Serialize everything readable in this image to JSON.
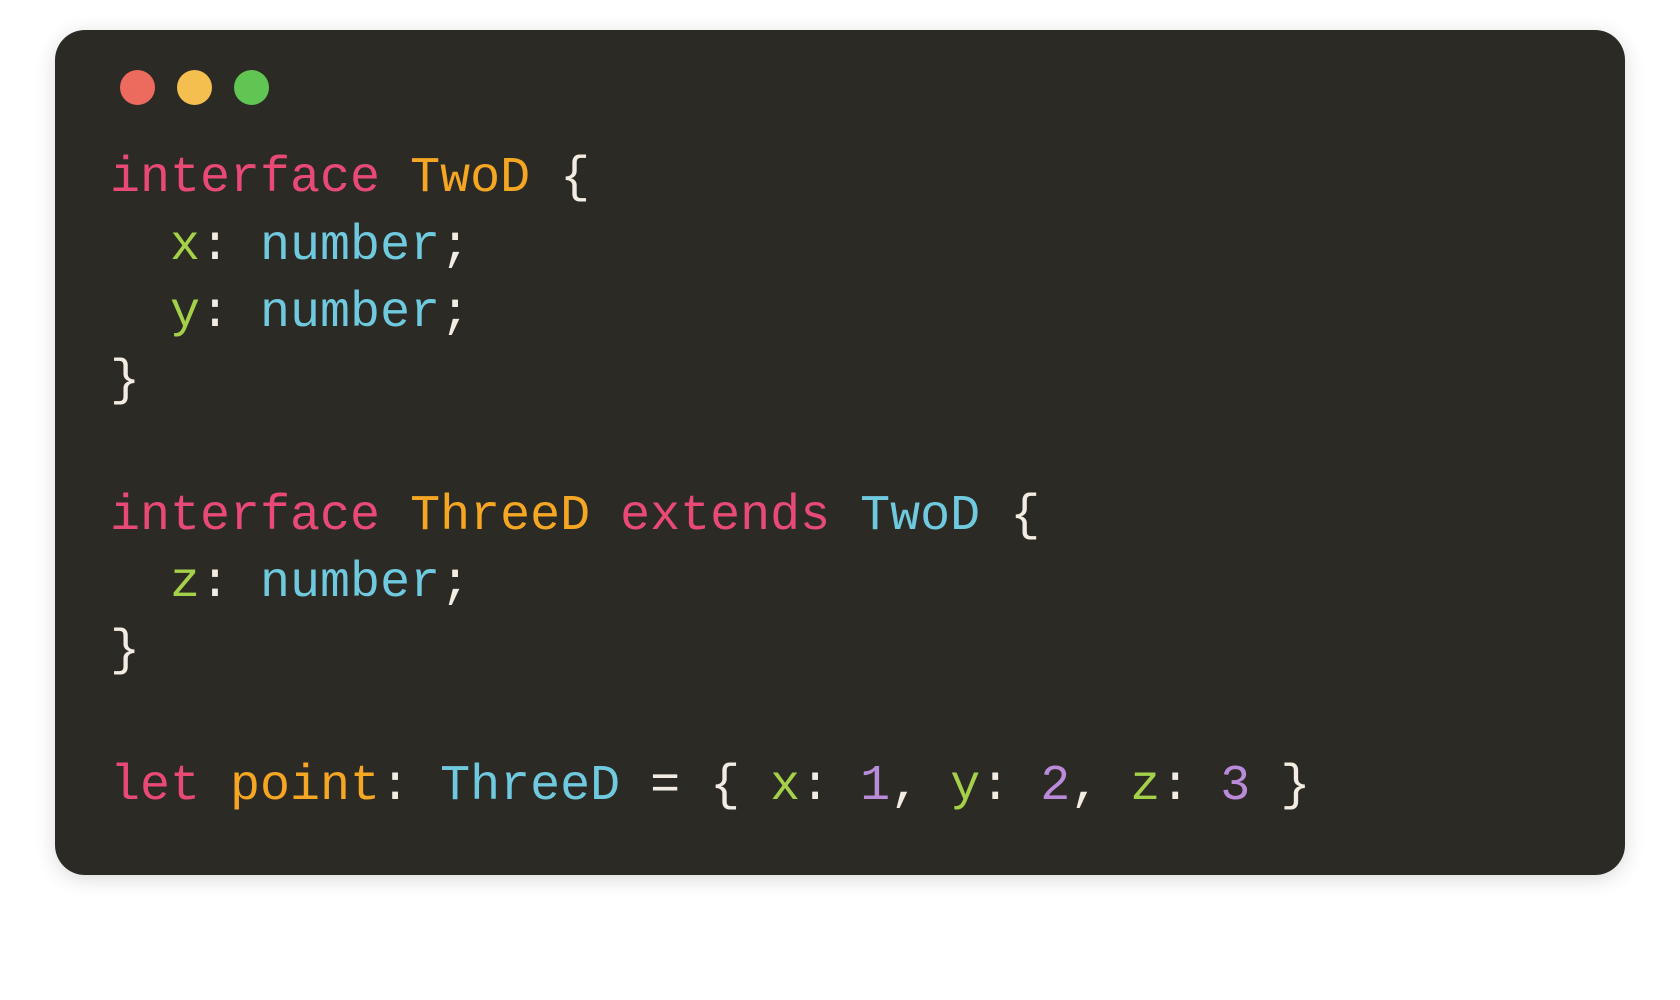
{
  "colors": {
    "window_bg": "#2c2a24",
    "traffic_red": "#ec6a5e",
    "traffic_yellow": "#f4bf4f",
    "traffic_green": "#61c554",
    "kw_interface": "#e84a75",
    "kw_extends": "#e84a75",
    "kw_let": "#e84a75",
    "type_name": "#f5a623",
    "type_ref": "#6fc9df",
    "prop_name": "#a4d04a",
    "type_number": "#6fc9df",
    "punct": "#f3ece2",
    "var_name": "#f5a623",
    "num_lit": "#b98bd9"
  },
  "code": {
    "lines": [
      [
        {
          "t": "interface",
          "c": "kw_interface"
        },
        {
          "t": " ",
          "c": "punct"
        },
        {
          "t": "TwoD",
          "c": "type_name"
        },
        {
          "t": " {",
          "c": "punct"
        }
      ],
      [
        {
          "t": "  ",
          "c": "punct"
        },
        {
          "t": "x",
          "c": "prop_name"
        },
        {
          "t": ": ",
          "c": "punct"
        },
        {
          "t": "number",
          "c": "type_number"
        },
        {
          "t": ";",
          "c": "punct"
        }
      ],
      [
        {
          "t": "  ",
          "c": "punct"
        },
        {
          "t": "y",
          "c": "prop_name"
        },
        {
          "t": ": ",
          "c": "punct"
        },
        {
          "t": "number",
          "c": "type_number"
        },
        {
          "t": ";",
          "c": "punct"
        }
      ],
      [
        {
          "t": "}",
          "c": "punct"
        }
      ],
      [],
      [
        {
          "t": "interface",
          "c": "kw_interface"
        },
        {
          "t": " ",
          "c": "punct"
        },
        {
          "t": "ThreeD",
          "c": "type_name"
        },
        {
          "t": " ",
          "c": "punct"
        },
        {
          "t": "extends",
          "c": "kw_extends"
        },
        {
          "t": " ",
          "c": "punct"
        },
        {
          "t": "TwoD",
          "c": "type_ref"
        },
        {
          "t": " {",
          "c": "punct"
        }
      ],
      [
        {
          "t": "  ",
          "c": "punct"
        },
        {
          "t": "z",
          "c": "prop_name"
        },
        {
          "t": ": ",
          "c": "punct"
        },
        {
          "t": "number",
          "c": "type_number"
        },
        {
          "t": ";",
          "c": "punct"
        }
      ],
      [
        {
          "t": "}",
          "c": "punct"
        }
      ],
      [],
      [
        {
          "t": "let",
          "c": "kw_let"
        },
        {
          "t": " ",
          "c": "punct"
        },
        {
          "t": "point",
          "c": "var_name"
        },
        {
          "t": ": ",
          "c": "punct"
        },
        {
          "t": "ThreeD",
          "c": "type_ref"
        },
        {
          "t": " = { ",
          "c": "punct"
        },
        {
          "t": "x",
          "c": "prop_name"
        },
        {
          "t": ": ",
          "c": "punct"
        },
        {
          "t": "1",
          "c": "num_lit"
        },
        {
          "t": ", ",
          "c": "punct"
        },
        {
          "t": "y",
          "c": "prop_name"
        },
        {
          "t": ": ",
          "c": "punct"
        },
        {
          "t": "2",
          "c": "num_lit"
        },
        {
          "t": ", ",
          "c": "punct"
        },
        {
          "t": "z",
          "c": "prop_name"
        },
        {
          "t": ": ",
          "c": "punct"
        },
        {
          "t": "3",
          "c": "num_lit"
        },
        {
          "t": " }",
          "c": "punct"
        }
      ]
    ]
  }
}
